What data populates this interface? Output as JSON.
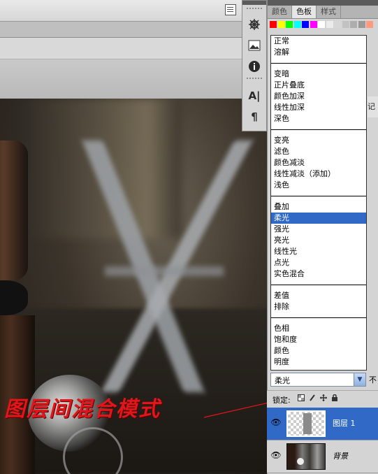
{
  "panel_tabs": [
    "颜色",
    "色板",
    "样式"
  ],
  "active_tab_index": 1,
  "side_peek_text": "记",
  "blend_modes": {
    "group1": [
      "正常",
      "溶解"
    ],
    "group2": [
      "变暗",
      "正片叠底",
      "颜色加深",
      "线性加深",
      "深色"
    ],
    "group3": [
      "变亮",
      "滤色",
      "颜色减淡",
      "线性减淡（添加）",
      "浅色"
    ],
    "group4": [
      "叠加",
      "柔光",
      "强光",
      "亮光",
      "线性光",
      "点光",
      "实色混合"
    ],
    "group5": [
      "差值",
      "排除"
    ],
    "group6": [
      "色相",
      "饱和度",
      "颜色",
      "明度"
    ]
  },
  "selected_blend_mode": "柔光",
  "blend_select_value": "柔光",
  "opacity_peek": "不",
  "lock_label": "锁定:",
  "layers": [
    {
      "name": "图层 1",
      "selected": true
    },
    {
      "name": "背景",
      "selected": false
    }
  ],
  "annotation_text": "图层间混合模式",
  "swatch_colors": [
    "#ff0000",
    "#ffff00",
    "#00ff00",
    "#00ffff",
    "#0000ff",
    "#ff00ff",
    "#ffffff",
    "#ebebeb",
    "#d6d6d6",
    "#c2c2c2",
    "#adadad",
    "#999999",
    "#ff9c80"
  ],
  "icons": [
    "page-icon",
    "compass-tool-icon",
    "image-tool-icon",
    "info-tool-icon",
    "character-tool-icon",
    "paragraph-tool-icon",
    "eye-icon",
    "lock-transparent-icon",
    "lock-brush-icon",
    "lock-move-icon",
    "lock-all-icon",
    "dropdown-arrow-icon"
  ]
}
